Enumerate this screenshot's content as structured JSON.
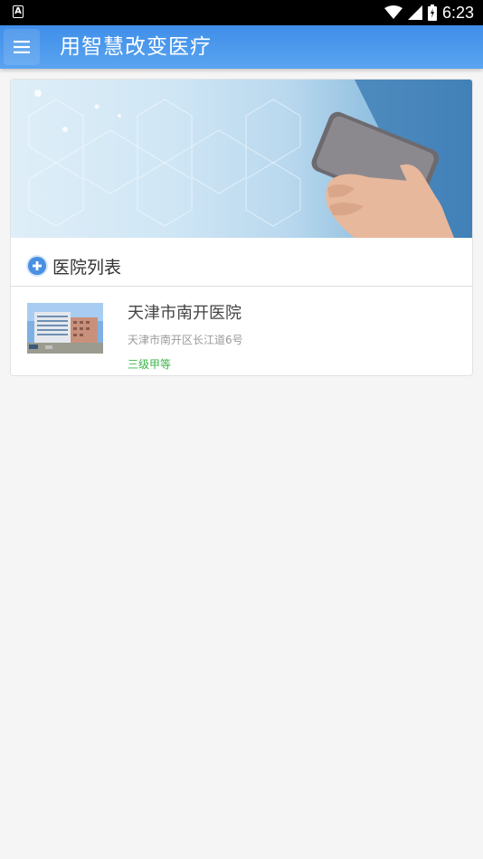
{
  "status_bar": {
    "time": "6:23",
    "notification_icon": "A",
    "icons": [
      "wifi-icon",
      "signal-icon",
      "battery-icon"
    ]
  },
  "app_bar": {
    "title": "用智慧改变医疗",
    "menu_icon": "hamburger-menu-icon",
    "color": "#4a97ec"
  },
  "section": {
    "title": "医院列表",
    "icon": "plus-circle-icon"
  },
  "hospitals": [
    {
      "name": "天津市南开医院",
      "address": "天津市南开区长江道6号",
      "level": "三级甲等"
    }
  ],
  "colors": {
    "accent": "#4a90e2",
    "level_green": "#3cb54a"
  }
}
